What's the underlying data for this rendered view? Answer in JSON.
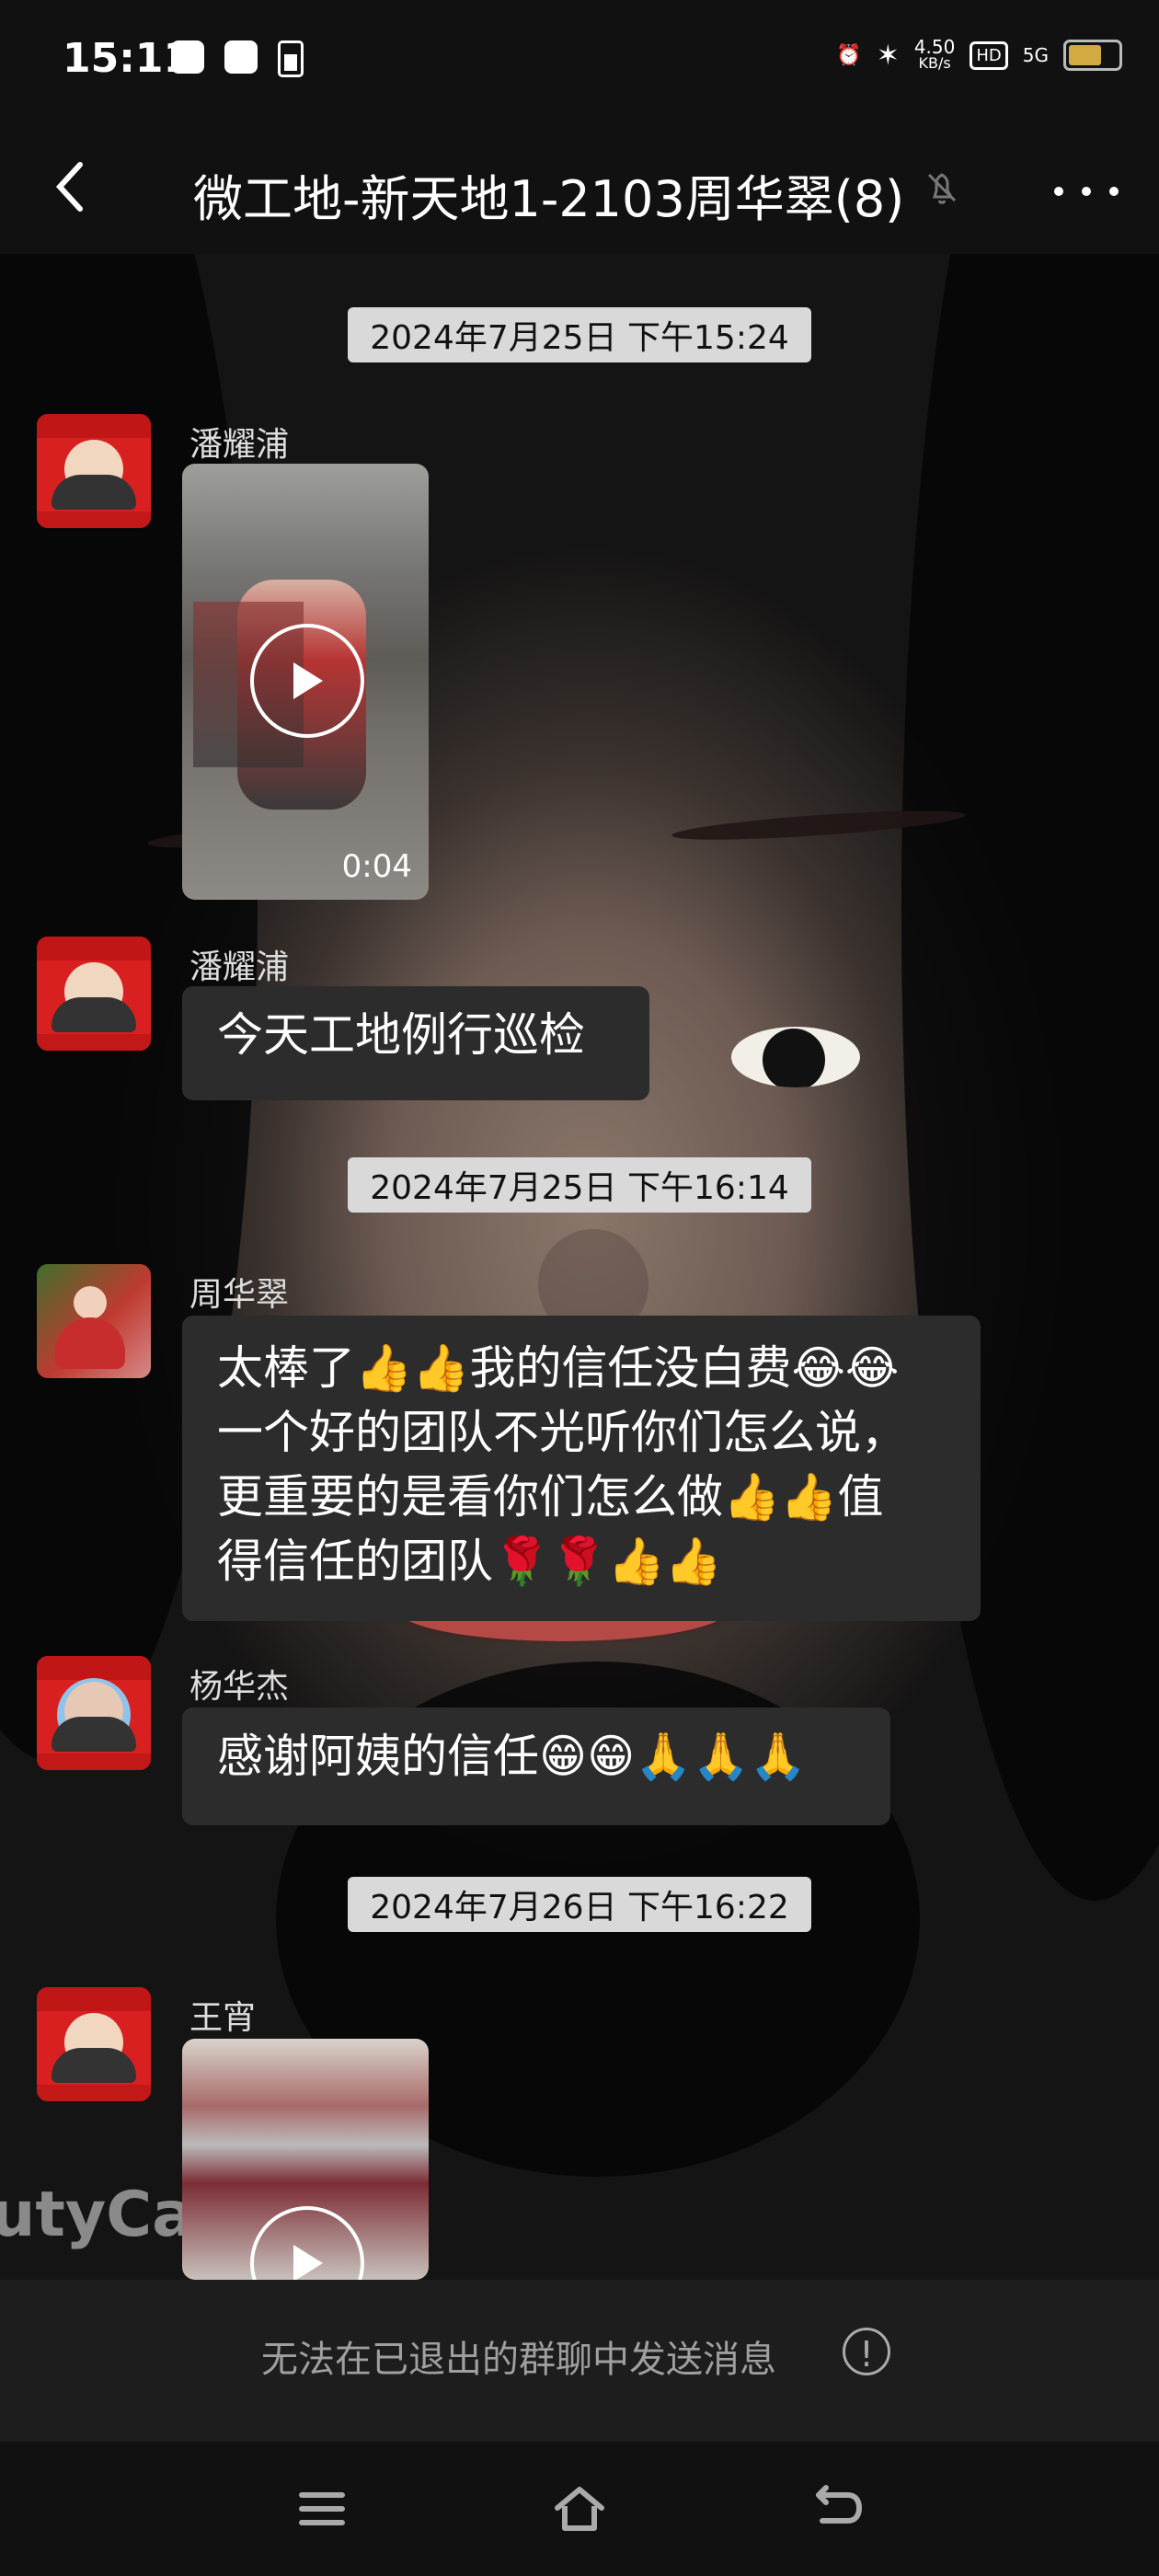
{
  "status": {
    "time": "15:11",
    "network_speed": "4.50",
    "network_unit": "KB/s",
    "hd_label": "HD",
    "signal_label": "5G",
    "battery_level_percent": 75
  },
  "header": {
    "title": "微工地-新天地1-2103周华翠(8)"
  },
  "chat": {
    "messages": [
      {
        "time": "2024年7月25日  下午15:24",
        "sender": "潘耀浦",
        "video_duration": "0:04"
      },
      {
        "sender": "潘耀浦",
        "text": "今天工地例行巡检"
      },
      {
        "time": "2024年7月25日  下午16:14",
        "sender": "周华翠",
        "lines": [
          "太棒了👍👍我的信任没白费😂😂",
          "一个好的团队不光听你们怎么说，",
          "更重要的是看你们怎么做👍👍值",
          "得信任的团队🌹🌹👍👍"
        ]
      },
      {
        "sender": "杨华杰",
        "text": "感谢阿姨的信任😁😁🙏🙏🙏"
      },
      {
        "time": "2024年7月26日  下午16:22",
        "sender": "王宵"
      }
    ]
  },
  "background": {
    "watermark": "utyCa"
  },
  "footer": {
    "notice": "无法在已退出的群聊中发送消息"
  },
  "colors": {
    "header_bg": "#111111",
    "bubble_bg": "#2c2c2c",
    "chip_bg": "#d9d9d9",
    "accent_red": "#d82020",
    "notice_text": "#9f9f9f"
  }
}
